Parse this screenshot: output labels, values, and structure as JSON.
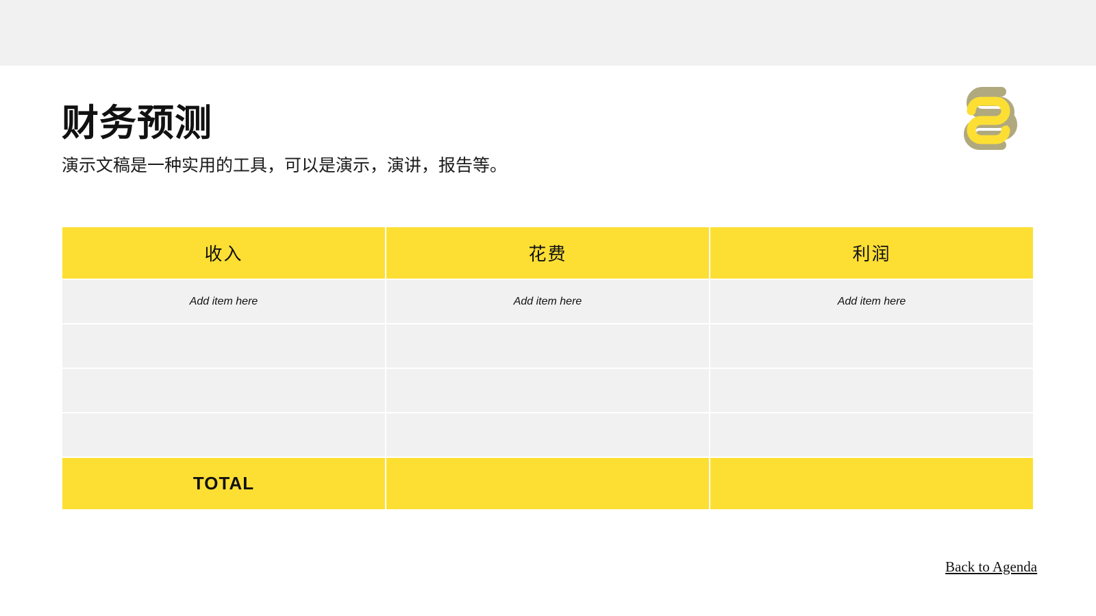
{
  "slide": {
    "title": "财务预测",
    "subtitle": "演示文稿是一种实用的工具，可以是演示，演讲，报告等。"
  },
  "logo": {
    "icon": "interlocking-loops-logo",
    "colors": {
      "yellow": "#fddf34",
      "olive": "#b0a97e"
    }
  },
  "table": {
    "headers": [
      "收入",
      "花费",
      "利润"
    ],
    "rows": [
      [
        "Add item here",
        "Add item here",
        "Add item here"
      ],
      [
        "",
        "",
        ""
      ],
      [
        "",
        "",
        ""
      ],
      [
        "",
        "",
        ""
      ]
    ],
    "total_row": [
      "TOTAL",
      "",
      ""
    ]
  },
  "footer": {
    "back_link": "Back to Agenda"
  },
  "colors": {
    "accent": "#fddf34",
    "row_bg": "#f1f1f1",
    "top_band": "#f1f1f1",
    "text": "#111111"
  }
}
